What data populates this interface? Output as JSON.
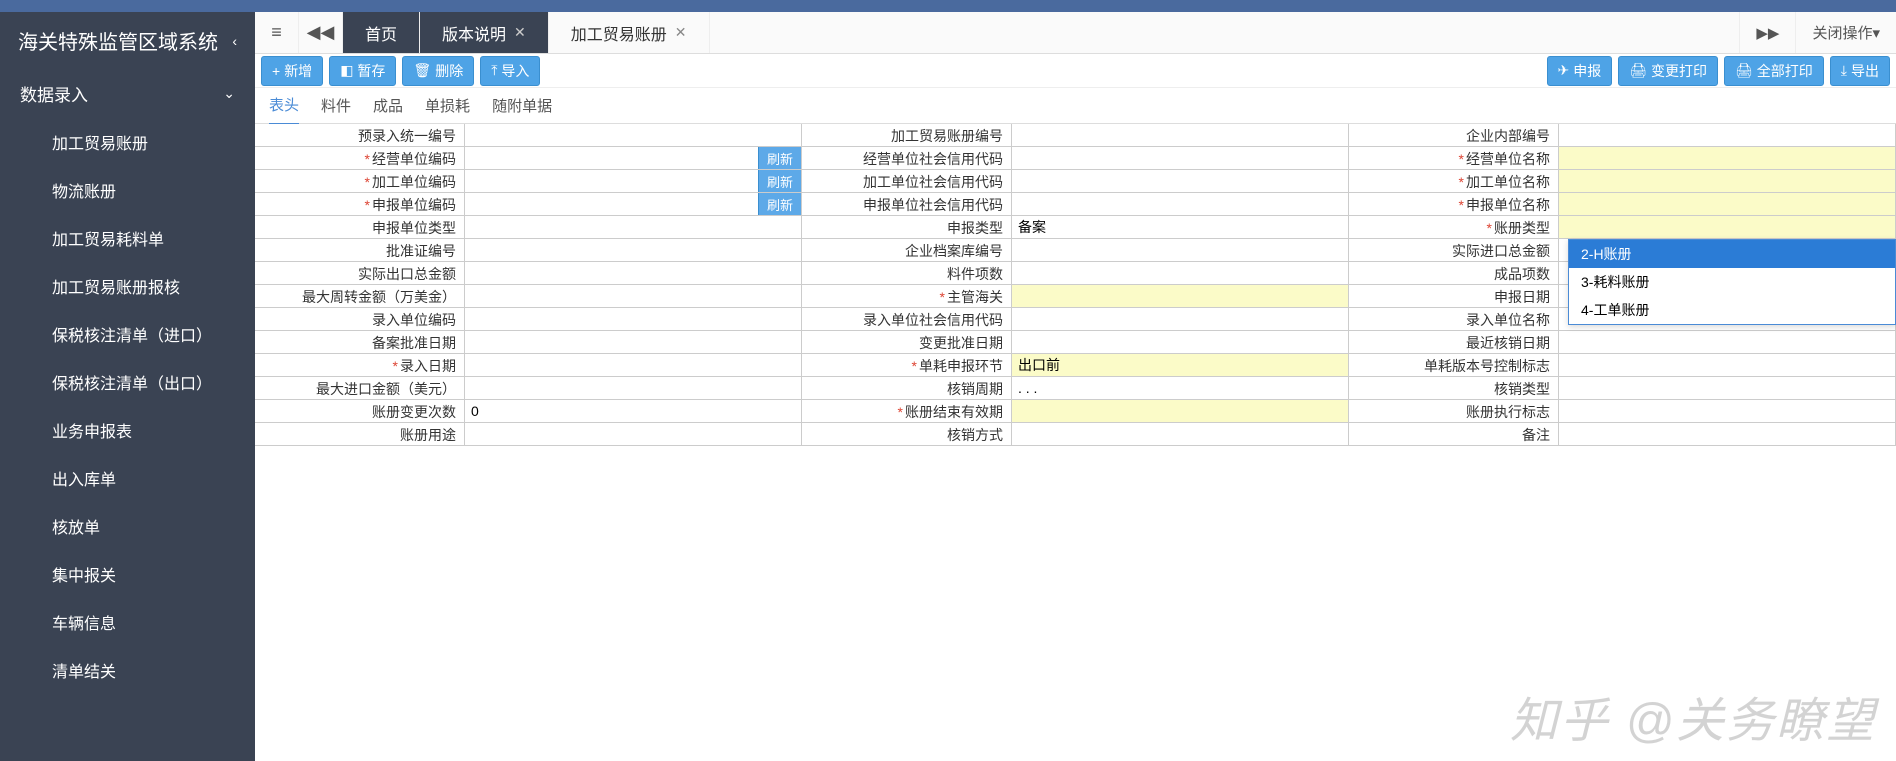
{
  "app_title": "海关特殊监管区域系统",
  "sidebar": {
    "section": "数据录入",
    "items": [
      "加工贸易账册",
      "物流账册",
      "加工贸易耗料单",
      "加工贸易账册报核",
      "保税核注清单（进口）",
      "保税核注清单（出口）",
      "业务申报表",
      "出入库单",
      "核放单",
      "集中报关",
      "车辆信息",
      "清单结关"
    ]
  },
  "tabs": {
    "home": "首页",
    "version": "版本说明",
    "current": "加工贸易账册",
    "close_ops": "关闭操作"
  },
  "toolbar": {
    "add": "新增",
    "save": "暂存",
    "delete": "删除",
    "import": "导入",
    "declare": "申报",
    "print_change": "变更打印",
    "print_all": "全部打印",
    "export": "导出"
  },
  "subtabs": [
    "表头",
    "料件",
    "成品",
    "单损耗",
    "随附单据"
  ],
  "refresh_label": "刷新",
  "form": {
    "rows": [
      [
        {
          "l": "预录入统一编号",
          "r": false
        },
        {
          "l": "加工贸易账册编号",
          "r": false
        },
        {
          "l": "企业内部编号",
          "r": false
        }
      ],
      [
        {
          "l": "经营单位编码",
          "r": true,
          "btn": true
        },
        {
          "l": "经营单位社会信用代码",
          "r": false
        },
        {
          "l": "经营单位名称",
          "r": true,
          "rb": true
        }
      ],
      [
        {
          "l": "加工单位编码",
          "r": true,
          "btn": true
        },
        {
          "l": "加工单位社会信用代码",
          "r": false
        },
        {
          "l": "加工单位名称",
          "r": true,
          "rb": true
        }
      ],
      [
        {
          "l": "申报单位编码",
          "r": true,
          "btn": true
        },
        {
          "l": "申报单位社会信用代码",
          "r": false
        },
        {
          "l": "申报单位名称",
          "r": true,
          "rb": true
        }
      ],
      [
        {
          "l": "申报单位类型",
          "r": false
        },
        {
          "l": "申报类型",
          "r": false,
          "v": "备案"
        },
        {
          "l": "账册类型",
          "r": true,
          "rb": true,
          "dd": true
        }
      ],
      [
        {
          "l": "批准证编号",
          "r": false
        },
        {
          "l": "企业档案库编号",
          "r": false
        },
        {
          "l": "实际进口总金额",
          "r": false
        }
      ],
      [
        {
          "l": "实际出口总金额",
          "r": false
        },
        {
          "l": "料件项数",
          "r": false
        },
        {
          "l": "成品项数",
          "r": false
        }
      ],
      [
        {
          "l": "最大周转金额（万美金）",
          "r": false
        },
        {
          "l": "主管海关",
          "r": true,
          "rb": true
        },
        {
          "l": "申报日期",
          "r": false
        }
      ],
      [
        {
          "l": "录入单位编码",
          "r": false
        },
        {
          "l": "录入单位社会信用代码",
          "r": false
        },
        {
          "l": "录入单位名称",
          "r": false
        }
      ],
      [
        {
          "l": "备案批准日期",
          "r": false
        },
        {
          "l": "变更批准日期",
          "r": false
        },
        {
          "l": "最近核销日期",
          "r": false
        }
      ],
      [
        {
          "l": "录入日期",
          "r": true
        },
        {
          "l": "单耗申报环节",
          "r": true,
          "v": "出口前",
          "rb": true
        },
        {
          "l": "单耗版本号控制标志",
          "r": false
        }
      ],
      [
        {
          "l": "最大进口金额（美元）",
          "r": false
        },
        {
          "l": "核销周期",
          "r": false,
          "v": ". . ."
        },
        {
          "l": "核销类型",
          "r": false
        }
      ],
      [
        {
          "l": "账册变更次数",
          "r": false,
          "v": "0"
        },
        {
          "l": "账册结束有效期",
          "r": true,
          "rb": true
        },
        {
          "l": "账册执行标志",
          "r": false
        }
      ],
      [
        {
          "l": "账册用途",
          "r": false
        },
        {
          "l": "核销方式",
          "r": false
        },
        {
          "l": "备注",
          "r": false
        }
      ]
    ]
  },
  "dropdown": {
    "options": [
      "2-H账册",
      "3-耗料账册",
      "4-工单账册"
    ],
    "selected": 0
  },
  "watermark": "知乎 @关务瞭望"
}
